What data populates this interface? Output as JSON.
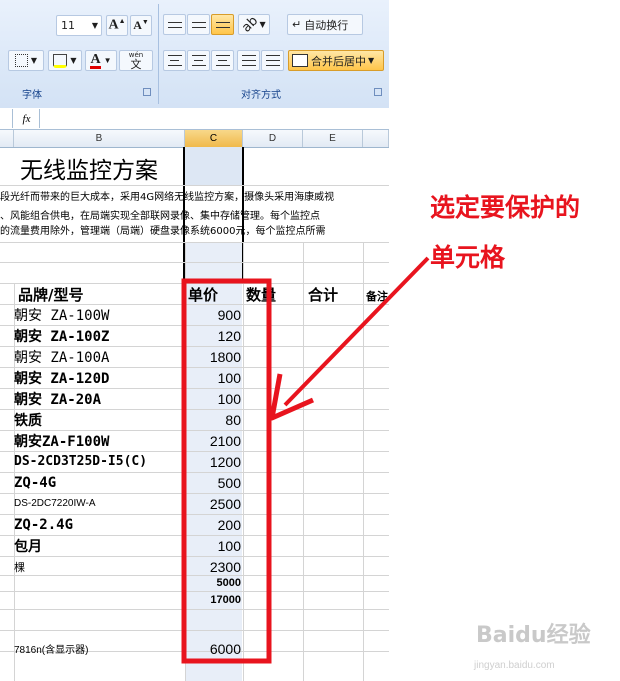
{
  "ribbon": {
    "font_size": "11",
    "font_group_label": "字体",
    "align_group_label": "对齐方式",
    "wrap_text_label": "自动换行",
    "merge_center_label": "合并后居中",
    "phonetic_label": "wén",
    "accent": "#ffc54a"
  },
  "formula_bar": {
    "fx_label": "fx",
    "value": ""
  },
  "columns": [
    "B",
    "C",
    "D",
    "E"
  ],
  "sheet": {
    "title": "无线监控方案",
    "intro_lines": [
      "段光纤而带来的巨大成本，采用4G网络无线监控方案，摄像头采用海康威视",
      "、风能组合供电，在局端实现全部联网录像、集中存储管理。每个监控点",
      "的流量费用除外，管理端（局端）硬盘录像系统6000元，每个监控点所需"
    ],
    "headers": {
      "brand": "品牌/型号",
      "price": "单价",
      "qty": "数量",
      "total": "合计",
      "note": "备注"
    },
    "rows": [
      {
        "brand": "朝安 ZA-100W",
        "price": "900"
      },
      {
        "brand": "朝安 ZA-100Z",
        "price": "120"
      },
      {
        "brand": "朝安 ZA-100A",
        "price": "1800"
      },
      {
        "brand": "朝安 ZA-120D",
        "price": "100"
      },
      {
        "brand": "朝安 ZA-20A",
        "price": "100"
      },
      {
        "brand": "铁质",
        "price": "80"
      },
      {
        "brand": "朝安ZA-F100W",
        "price": "2100"
      },
      {
        "brand": "DS-2CD3T25D-I5(C)",
        "price": "1200"
      },
      {
        "brand": "ZQ-4G",
        "price": "500"
      },
      {
        "brand": "DS-2DC7220IW-A",
        "price": "2500"
      },
      {
        "brand": "ZQ-2.4G",
        "price": "200"
      },
      {
        "brand": "包月",
        "price": "100"
      },
      {
        "brand": "棵",
        "price": "2300"
      },
      {
        "brand": "",
        "price": "5000"
      },
      {
        "brand": "",
        "price": "17000"
      },
      {
        "brand": "",
        "price": ""
      },
      {
        "brand": "",
        "price": ""
      },
      {
        "brand": "7816n(含显示器)",
        "price": "6000"
      }
    ]
  },
  "annotation": {
    "line1": "选定要保护的",
    "line2": "单元格",
    "color": "#e8141e"
  },
  "watermark": {
    "brand": "Baidu经验",
    "url": "jingyan.baidu.com"
  }
}
